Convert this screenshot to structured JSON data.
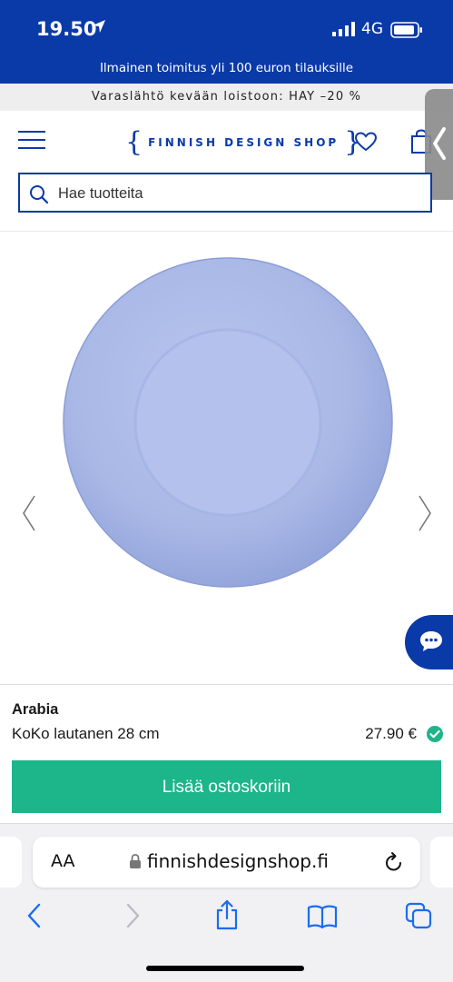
{
  "status_bar": {
    "time": "19.50",
    "network": "4G"
  },
  "promo": {
    "text": "Ilmainen toimitus yli 100 euron tilauksille"
  },
  "announcement": {
    "text": "Varaslähtö kevään loistoon: HAY –20 %"
  },
  "header": {
    "logo_text": "FINNISH DESIGN SHOP"
  },
  "search": {
    "placeholder": "Hae tuotteita"
  },
  "product": {
    "brand": "Arabia",
    "name": "KoKo lautanen 28 cm",
    "price": "27.90 €",
    "add_to_cart_label": "Lisää ostoskoriin"
  },
  "browser": {
    "text_size_label": "AA",
    "url": "finnishdesignshop.fi"
  },
  "colors": {
    "brand_blue": "#0a3aa8",
    "cta_green": "#1db58a",
    "plate": "#aab9e8"
  }
}
